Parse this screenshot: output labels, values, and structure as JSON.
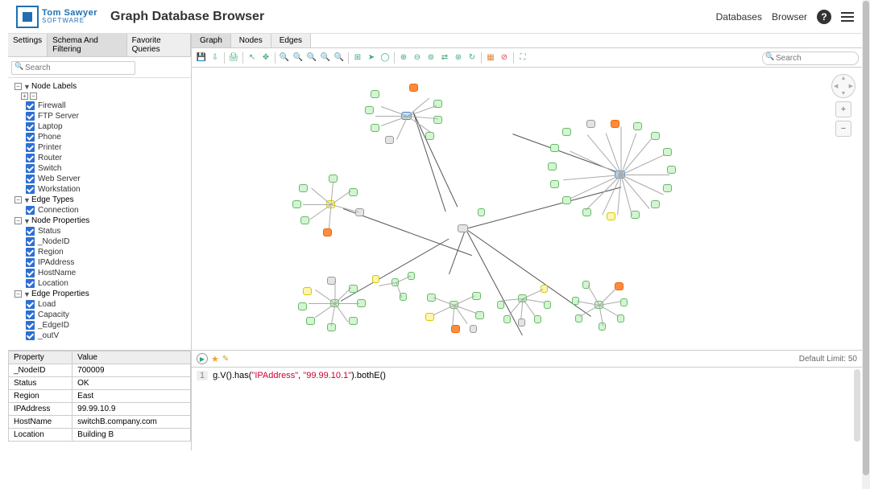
{
  "header": {
    "logo_top": "Tom Sawyer",
    "logo_bottom": "SOFTWARE",
    "title": "Graph Database Browser",
    "links": {
      "databases": "Databases",
      "browser": "Browser"
    }
  },
  "left_tabs": {
    "settings": "Settings",
    "schema": "Schema And Filtering",
    "favorites": "Favorite Queries"
  },
  "left_search": {
    "placeholder": "Search"
  },
  "tree": {
    "node_labels": {
      "label": "Node Labels",
      "items": [
        "Firewall",
        "FTP Server",
        "Laptop",
        "Phone",
        "Printer",
        "Router",
        "Switch",
        "Web Server",
        "Workstation"
      ]
    },
    "edge_types": {
      "label": "Edge Types",
      "items": [
        "Connection"
      ]
    },
    "node_props": {
      "label": "Node Properties",
      "items": [
        "Status",
        "_NodeID",
        "Region",
        "IPAddress",
        "HostName",
        "Location"
      ]
    },
    "edge_props": {
      "label": "Edge Properties",
      "items": [
        "Load",
        "Capacity",
        "_EdgeID",
        "_outV"
      ]
    }
  },
  "right_tabs": {
    "graph": "Graph",
    "nodes": "Nodes",
    "edges": "Edges"
  },
  "toolbar_search": {
    "placeholder": "Search"
  },
  "properties": {
    "headers": {
      "key": "Property",
      "value": "Value"
    },
    "rows": [
      {
        "k": "_NodeID",
        "v": "700009"
      },
      {
        "k": "Status",
        "v": "OK"
      },
      {
        "k": "Region",
        "v": "East"
      },
      {
        "k": "IPAddress",
        "v": "99.99.10.9"
      },
      {
        "k": "HostName",
        "v": "switchB.company.com"
      },
      {
        "k": "Location",
        "v": "Building B"
      }
    ]
  },
  "query": {
    "limit_label": "Default Limit: 50",
    "line": "1",
    "prefix": "g.V().has(",
    "arg1": "\"IPAddress\"",
    "sep": ", ",
    "arg2": "\"99.99.10.1\"",
    "suffix": ").bothE()"
  }
}
